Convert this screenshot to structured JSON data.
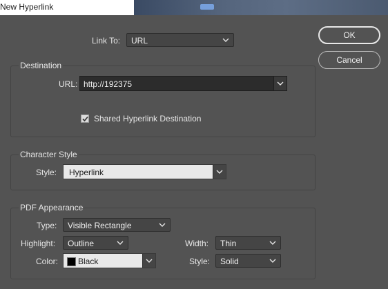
{
  "window": {
    "title": "New Hyperlink"
  },
  "link_to": {
    "label": "Link To:",
    "value": "URL"
  },
  "buttons": {
    "ok": "OK",
    "cancel": "Cancel"
  },
  "destination": {
    "title": "Destination",
    "url_label": "URL:",
    "url_value": "http://192375",
    "shared_label": "Shared Hyperlink Destination",
    "shared_checked": true
  },
  "character_style": {
    "title": "Character Style",
    "style_label": "Style:",
    "style_value": "Hyperlink"
  },
  "pdf_appearance": {
    "title": "PDF Appearance",
    "type_label": "Type:",
    "type_value": "Visible Rectangle",
    "highlight_label": "Highlight:",
    "highlight_value": "Outline",
    "color_label": "Color:",
    "color_value": "Black",
    "color_swatch": "#000000",
    "width_label": "Width:",
    "width_value": "Thin",
    "style_label": "Style:",
    "style_value": "Solid"
  }
}
